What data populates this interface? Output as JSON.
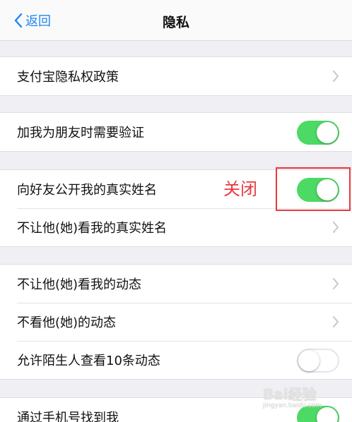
{
  "nav": {
    "back_label": "返回",
    "title": "隐私"
  },
  "groups": [
    {
      "rows": [
        {
          "label": "支付宝隐私权政策",
          "control": "chevron"
        }
      ]
    },
    {
      "rows": [
        {
          "label": "加我为朋友时需要验证",
          "control": "toggle",
          "on": true
        }
      ]
    },
    {
      "rows": [
        {
          "label": "向好友公开我的真实姓名",
          "control": "toggle",
          "on": true
        },
        {
          "label": "不让他(她)看我的真实姓名",
          "control": "chevron"
        }
      ]
    },
    {
      "rows": [
        {
          "label": "不让他(她)看我的动态",
          "control": "chevron"
        },
        {
          "label": "不看他(她)的动态",
          "control": "chevron"
        },
        {
          "label": "允许陌生人查看10条动态",
          "control": "toggle",
          "on": false
        }
      ]
    },
    {
      "rows": [
        {
          "label": "通过手机号找到我",
          "control": "toggle",
          "on": true
        }
      ]
    }
  ],
  "annotation": {
    "text": "关闭"
  },
  "watermark": {
    "text": "Bai经验",
    "sub": "jingyan.baidu.com"
  },
  "colors": {
    "accent": "#1e86f0",
    "toggle_on": "#4cd964",
    "annotation": "#e8383d"
  }
}
